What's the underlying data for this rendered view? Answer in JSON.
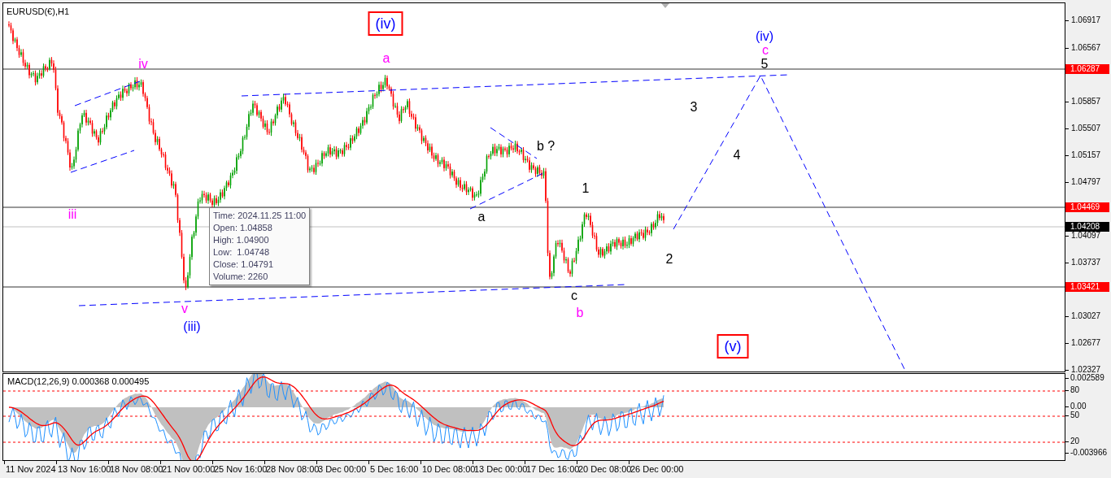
{
  "chart": {
    "title": "EURUSD(€),H1",
    "wave_labels": [
      {
        "text": "(iv)",
        "kind": "boxed",
        "color": "#0000ff"
      },
      {
        "text": "a",
        "kind": "plain",
        "color": "#ff00ff"
      },
      {
        "text": "iv",
        "kind": "plain",
        "color": "#ff00ff"
      },
      {
        "text": "iii",
        "kind": "plain",
        "color": "#ff00ff"
      },
      {
        "text": "v",
        "kind": "plain",
        "color": "#ff00ff"
      },
      {
        "text": "(iii)",
        "kind": "plain",
        "color": "#0000ff"
      },
      {
        "text": "b ?",
        "kind": "plain",
        "color": "#000000"
      },
      {
        "text": "a",
        "kind": "plain",
        "color": "#000000"
      },
      {
        "text": "1",
        "kind": "plain",
        "color": "#000000"
      },
      {
        "text": "c",
        "kind": "plain",
        "color": "#000000"
      },
      {
        "text": "b",
        "kind": "plain",
        "color": "#ff00ff"
      },
      {
        "text": "2",
        "kind": "plain",
        "color": "#000000"
      },
      {
        "text": "3",
        "kind": "plain",
        "color": "#000000"
      },
      {
        "text": "4",
        "kind": "plain",
        "color": "#000000"
      },
      {
        "text": "(iv)",
        "kind": "plain",
        "color": "#0000ff"
      },
      {
        "text": "c",
        "kind": "plain",
        "color": "#ff00ff"
      },
      {
        "text": "5",
        "kind": "plain",
        "color": "#000000"
      },
      {
        "text": "(v)",
        "kind": "boxed",
        "color": "#0000ff"
      }
    ],
    "tooltip": {
      "lines": [
        "Time: 2024.11.25 11:00",
        "Open: 1.04858",
        "High: 1.04900",
        "Low:  1.04748",
        "Close: 1.04791",
        "Volume: 2260"
      ]
    }
  },
  "price_axis": {
    "ticks": [
      "1.06917",
      "1.06567",
      "1.05857",
      "1.05507",
      "1.05157",
      "1.04797",
      "1.04097",
      "1.03737",
      "1.03027",
      "1.02677",
      "1.02327"
    ],
    "price_tags": [
      {
        "text": "1.06287",
        "kind": "level"
      },
      {
        "text": "1.04469",
        "kind": "level"
      },
      {
        "text": "1.04208",
        "kind": "current"
      },
      {
        "text": "1.03421",
        "kind": "level"
      }
    ]
  },
  "macd": {
    "title": "MACD(12,26,9) 0.000368 0.000495",
    "axis_labels": [
      "0.002589",
      "80",
      "0.00",
      "50",
      "20",
      "-0.003966"
    ]
  },
  "time_axis": {
    "labels": [
      "11 Nov 2024",
      "13 Nov 16:00",
      "18 Nov 08:00",
      "21 Nov 00:00",
      "25 Nov 16:00",
      "28 Nov 08:00",
      "3 Dec 00:00",
      "5 Dec 16:00",
      "10 Dec 08:00",
      "13 Dec 00:00",
      "17 Dec 16:00",
      "20 Dec 08:00",
      "26 Dec 00:00"
    ]
  }
}
